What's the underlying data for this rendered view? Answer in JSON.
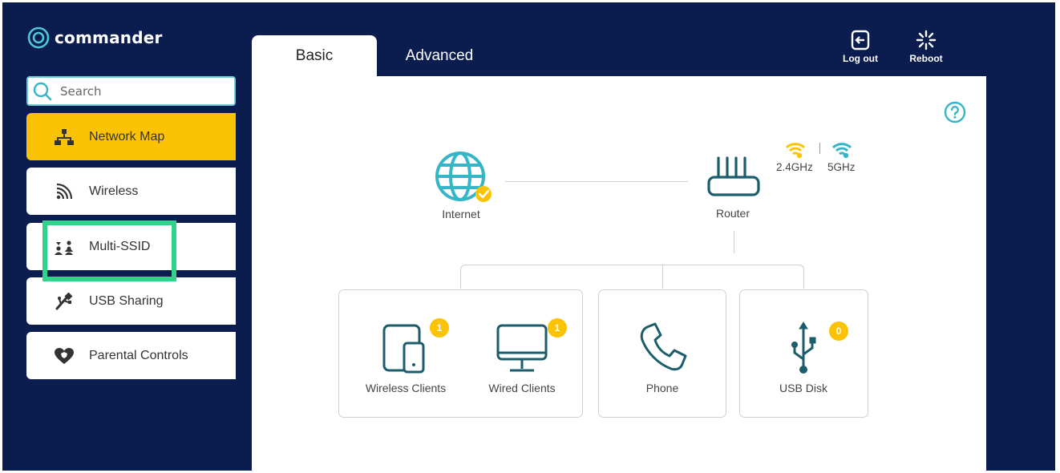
{
  "brand": {
    "name": "commander"
  },
  "search": {
    "placeholder": "Search"
  },
  "sidebar": {
    "items": [
      {
        "label": "Network Map",
        "icon": "network-map-icon",
        "active": true
      },
      {
        "label": "Wireless",
        "icon": "wireless-icon",
        "active": false
      },
      {
        "label": "Multi-SSID",
        "icon": "users-icon",
        "active": false
      },
      {
        "label": "USB Sharing",
        "icon": "usb-sharing-icon",
        "active": false
      },
      {
        "label": "Parental Controls",
        "icon": "heart-shield-icon",
        "active": false
      }
    ]
  },
  "tabs": [
    {
      "label": "Basic",
      "active": true
    },
    {
      "label": "Advanced",
      "active": false
    }
  ],
  "header": {
    "logout_label": "Log out",
    "reboot_label": "Reboot"
  },
  "map": {
    "internet_label": "Internet",
    "router_label": "Router",
    "band_24": "2.4GHz",
    "band_5": "5GHz",
    "devices": {
      "wireless_clients": {
        "label": "Wireless Clients",
        "count": "1"
      },
      "wired_clients": {
        "label": "Wired Clients",
        "count": "1"
      },
      "phone": {
        "label": "Phone"
      },
      "usb_disk": {
        "label": "USB Disk",
        "count": "0"
      }
    }
  },
  "colors": {
    "background": "#0b1d4f",
    "accent_yellow": "#fbc303",
    "icon_teal": "#1b5d6b",
    "globe_teal": "#35b6c8",
    "highlight_green": "#2fd48a"
  }
}
